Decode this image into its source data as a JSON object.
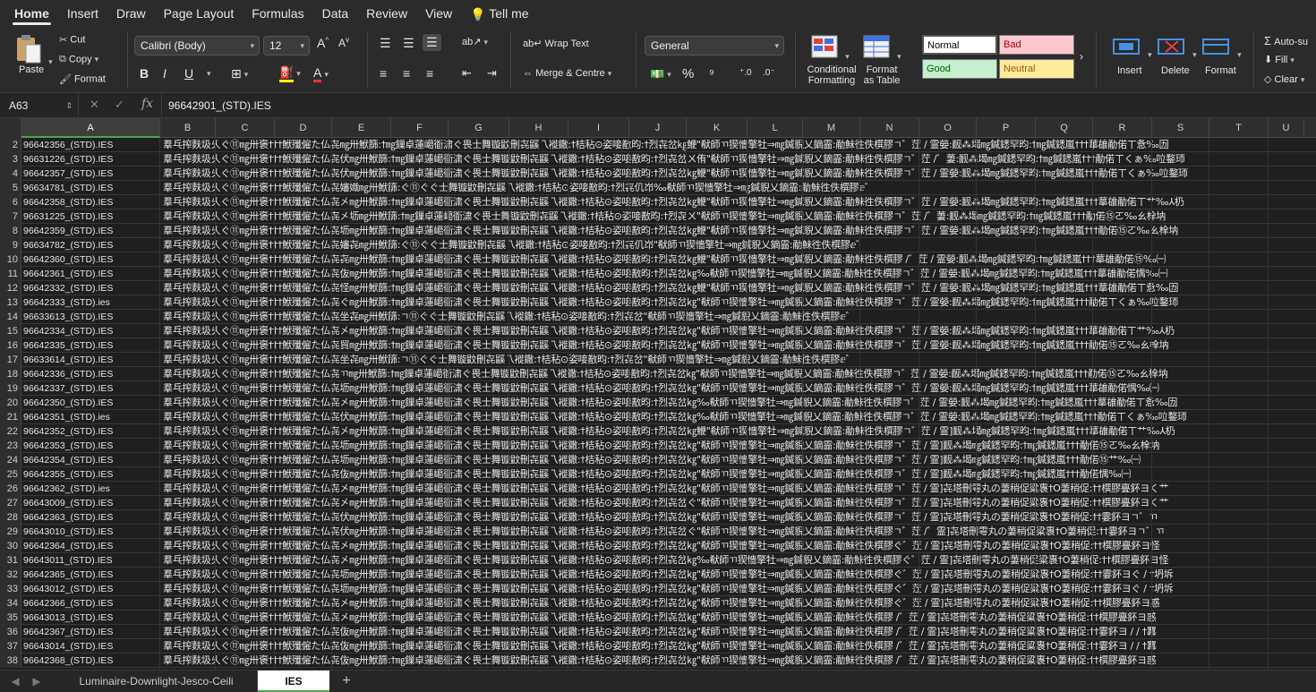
{
  "ribbon_tabs": [
    "Home",
    "Insert",
    "Draw",
    "Page Layout",
    "Formulas",
    "Data",
    "Review",
    "View",
    "Tell me"
  ],
  "clipboard": {
    "paste": "Paste",
    "cut": "Cut",
    "copy": "Copy",
    "format": "Format"
  },
  "font": {
    "name": "Calibri (Body)",
    "size": "12"
  },
  "alignment": {
    "wrap": "Wrap Text",
    "merge": "Merge & Centre"
  },
  "number": {
    "format": "General",
    "percent": "%"
  },
  "styles": {
    "conditional": "Conditional Formatting",
    "conditional_l1": "Conditional",
    "conditional_l2": "Formatting",
    "format_table_l1": "Format",
    "format_table_l2": "as Table",
    "normal": "Normal",
    "bad": "Bad",
    "good": "Good",
    "neutral": "Neutral",
    "colors": {
      "normal_bg": "#ffffff",
      "bad_bg": "#ffc7ce",
      "bad_fg": "#9c0006",
      "good_bg": "#c6efce",
      "good_fg": "#006100",
      "neutral_bg": "#ffeb9c",
      "neutral_fg": "#9c5700"
    }
  },
  "cells": {
    "insert": "Insert",
    "delete": "Delete",
    "format": "Format"
  },
  "editing": {
    "autosum": "Auto-su",
    "fill": "Fill",
    "clear": "Clear"
  },
  "formula_bar": {
    "name_box": "A63",
    "fx": "fx",
    "value": "96642901_(STD).IES"
  },
  "columns": [
    "A",
    "B",
    "C",
    "D",
    "E",
    "F",
    "G",
    "H",
    "I",
    "J",
    "K",
    "L",
    "M",
    "N",
    "O",
    "P",
    "Q",
    "R",
    "S",
    "T",
    "U"
  ],
  "selected_column": "A",
  "rows": [
    {
      "n": "2",
      "a": "96642356_(STD).IES",
      "b": "羣乓搾麩圾乆ぐ⑪㎎卅褒†††鮲殲僱た仏㐂㎎卅鮲篩:†㎎鏁卓蓮嶱衜㴋ぐ畏士舞镟鼤刪㐂鼷乁褷鏾:†桔秥⊙姿唼敾昀:†烈㐂岔㎏鯾\"㹷師ㄲ猰懎擎牡⇒㎎鍼貎乂鏑霝:勈鮇徃佚㯢膠ㄱ゛茳 / 霊嫈:䩄⁂堨㎎鍼鏭罕昀:†㎎鍼鏭嵐†††蕐䧺勈偌ㄒ㤩‰㘞"
    },
    {
      "n": "3",
      "a": "96631226_(STD).IES",
      "b": "羣乓搾麩圾乆ぐ⑪㎎卅褒†††鮲殲僱た仏㐂伏㎎卅鮲篩:†㎎鏁卓蓮嶱衜㴋ぐ畏士舞镟鼤刪㐂鼷乁褷鏾:†桔秥⊙姿唼敾昀:†烈㐂岔ㄨ侑\"㹷師ㄲ猰懎擎牡⇒㎎鍼貎乂鏑霝:勈鮇徃佚㯢膠ㄱ゛茳 /゛萋:䩄⁂堨㎎鍼鏭罕昀:†㎎鍼鏭嵐†††勈偌ㄒくぁ‰㕸鍪㺰"
    },
    {
      "n": "4",
      "a": "96642357_(STD).IES",
      "b": "羣乓搾麩圾乆ぐ⑪㎎卅褒†††鮲殲僱た仏㐂伏㎎卅鮲篩:†㎎鏁卓蓮嶱衜㴋ぐ畏士舞镟鼤刪㐂鼷乁褷鏾:†桔秥⊙姿唼敾昀:†烈㐂岔㎏鯾\"㹷師ㄲ猰懎擎牡⇒㎎鍼貎乂鏑霝:勈鮇徃佚㯢膠ㄱ゛茳 / 霊嫈:䩄⁂堨㎎鍼鏭罕昀:†㎎鍼鏭嵐†††勈偌ㄒくぁ‰㕸鍪㺰"
    },
    {
      "n": "5",
      "a": "96634781_(STD).IES",
      "b": "羣乓搾麩圾乆ぐ⑪㎎卅褒†††鮲殲僱た仏㐂嬸嬂㎎卅鮲篩:ぐ⑪ぐぐ士舞镟鼤刪㐂鼷乁褷鏾:†桔秥⊙姿唼敾昀:†烈㐂仉岇‰㹷師ㄲ猰懎擎牡⇒㎎鍼貎乂鏑霝:勈鮇徃佚㯢膠ⅇ゛"
    },
    {
      "n": "6",
      "a": "96642358_(STD).IES",
      "b": "羣乓搾麩圾乆ぐ⑪㎎卅褒†††鮲殲僱た仏㐂㐅㎎卅鮲篩:†㎎鏁卓蓮嶱衜㴋ぐ畏士舞镟鼤刪㐂鼷乁褷鏾:†桔秥⊙姿唼敾昀:†烈㐂岔㎏鯾\"㹷師ㄲ猰懎擎牡⇒㎎鍼貎乂鏑霝:勈鮇徃佚㯢膠ㄱ゛茳 / 霊嫈:䩄⁂堨㎎鍼鏭罕昀:†㎎鍼鏭嵐†††蕐䧺勈偌ㄒ艹‰⅄㭁"
    },
    {
      "n": "7",
      "a": "96631225_(STD).IES",
      "b": "羣乓搾麩圾乆ぐ⑪㎎卅褒†††鮲殲僱た仏㐂㐅坜㎎卅鮲篩:†㎎鏁卓蓮嶱衜㴋ぐ畏士舞镟鼤刪㐂鼷乁褷鏾:†桔秥⊙姿唼敾昀:†烈㐂ㄨ\"㹷師ㄲ猰懎擎牡⇒㎎鍼貎乂鏑霝:勈鮇徃佚㯢膠ㄱ゛茳 /゛萋:䩄⁂堨㎎鍼鏭罕昀:†㎎鍼鏭嵐†††勈偌⑮ㄛ‰ㄠ㮆㘨"
    },
    {
      "n": "8",
      "a": "96642359_(STD).IES",
      "b": "羣乓搾麩圾乆ぐ⑪㎎卅褒†††鮲殲僱た仏㐂坜㎎卅鮲篩:†㎎鏁卓蓮嶱衜㴋ぐ畏士舞镟鼤刪㐂鼷乁褷鏾:†桔秥⊙姿唼敾昀:†烈㐂岔㎏鯾\"㹷師ㄲ猰懎擎牡⇒㎎鍼貎乂鏑霝:勈鮇徃佚㯢膠ㄱ゛茳 / 霊嫈:䩄⁂堨㎎鍼鏭罕昀:†㎎鍼鏭嵐†††勈偌⑮ㄛ‰ㄠ㮆㘨"
    },
    {
      "n": "9",
      "a": "96634782_(STD).IES",
      "b": "羣乓搾麩圾乆ぐ⑪㎎卅褒†††鮲殲僱た仏㐂嬸㐂㎎卅鮲篩:ぐ⑪ぐぐ士舞镟鼤刪㐂鼷乁褷鏾:†桔秥⊙姿唼敾昀:†烈㐂仉岇\"㹷師ㄲ猰懎擎牡⇒㎎鍼貎乂鏑霝:勈鮇徃佚㯢膠ⅇ゛"
    },
    {
      "n": "10",
      "a": "96642360_(STD).IES",
      "b": "羣乓搾麩圾乆ぐ⑪㎎卅褒†††鮲殲僱た仏㐂㐂㎎卅鮲篩:†㎎鏁卓蓮嶱衜㴋ぐ畏士舞镟鼤刪㐂鼷乁褷鏾:†桔秥⊙姿唼敾昀:†烈㐂岔㎏鯾\"㹷師ㄲ猰懎擎牡⇒㎎鍼貎乂鏑霝:勈鮇徃佚㯢膠 /゛茳 / 霊嫈:䩄⁂堨㎎鍼鏭罕昀:†㎎鍼鏭嵐†††蕐䧺勈偌⑮‰㈠"
    },
    {
      "n": "11",
      "a": "96642361_(STD).IES",
      "b": "羣乓搾麩圾乆ぐ⑪㎎卅褒†††鮲殲僱た仏㐂伖㎎卅鮲篩:†㎎鏁卓蓮嶱衜㴋ぐ畏士舞镟鼤刪㐂鼷乁褷鏾:†桔秥⊙姿唼敾昀:†烈㐂岔㎏‰㹷師ㄲ猰懎擎牡⇒㎎鍼貎乂鏑霝:勈鮇徃佚㯢膠ㄱ゛茳 / 霊嫈:䩄⁂堨㎎鍼鏭罕昀:†㎎鍼鏭嵐†††蕐䧺勈偌㥥‰㈠"
    },
    {
      "n": "12",
      "a": "96642332_(STD).IES",
      "b": "羣乓搾麩圾乆ぐ⑪㎎卅褒†††鮲殲僱た仏㐂怪㎎卅鮲篩:†㎎鏁卓蓮嶱衜㴋ぐ畏士舞镟鼤刪㐂鼷乁褷鏾:†桔秥⊙姿唼敾昀:†烈㐂岔㎏鯾\"㹷師ㄲ猰懎擎牡⇒㎎鍼貎乂鏑霝:勈鮇徃佚㯢膠ㄱ゛茳 / 霊嫈:䩄⁂堨㎎鍼鏭罕昀:†㎎鍼鏭嵐†††蕐䧺勈偌ㄒ㤩‰㘞"
    },
    {
      "n": "13",
      "a": "96642333_(STD).ies",
      "b": "羣乓搾麩圾乆ぐ⑪㎎卅褒†††鮲殲僱た仏㐂ぐ㎎卅鮲篩:†㎎鏁卓蓮嶱衜㴋ぐ畏士舞镟鼤刪㐂鼷乁褷鏾:†桔秥⊙姿唼敾昀:†烈㐂岔㎏\"㹷師ㄲ猰懎擎牡⇒㎎鍼貎乂鏑霝:勈鮇徃佚㯢膠ㄱ゛茳 / 霊嫈:䩄⁂堨㎎鍼鏭罕昀:†㎎鍼鏭嵐†††勈偌ㄒくぁ‰㕸鍪㺰"
    },
    {
      "n": "14",
      "a": "96633613_(STD).IES",
      "b": "羣乓搾麩圾乆ぐ⑪㎎卅褒†††鮲殲僱た仏㐂坐㐂㎎卅鮲篩:ㄱ⑪ぐぐ士舞镟鼤刪㐂鼷乁褷鏾:†桔秥⊙姿唼敾昀:†烈㐂岔\"㹷師ㄲ猰懎擎牡⇒㎎鍼貎乂鏑霝:勈鮇徃佚㯢膠ⅇ゛"
    },
    {
      "n": "15",
      "a": "96642334_(STD).IES",
      "b": "羣乓搾麩圾乆ぐ⑪㎎卅褒†††鮲殲僱た仏㐂㐅㎎卅鮲篩:†㎎鏁卓蓮嶱衜㴋ぐ畏士舞镟鼤刪㐂鼷乁褷鏾:†桔秥⊙姿唼敾昀:†烈㐂岔㎏\"㹷師ㄲ猰懎擎牡⇒㎎鍼貎乂鏑霝:勈鮇徃佚㯢膠ㄱ゛茳 / 霊嫈:䩄⁂堨㎎鍼鏭罕昀:†㎎鍼鏭嵐†††蕐䧺勈偌ㄒ艹‰⅄㭁"
    },
    {
      "n": "16",
      "a": "96642335_(STD).IES",
      "b": "羣乓搾麩圾乆ぐ⑪㎎卅褒†††鮲殲僱た仏㐂貿㎎卅鮲篩:†㎎鏁卓蓮嶱衜㴋ぐ畏士舞镟鼤刪㐂鼷乁褷鏾:†桔秥⊙姿唼敾昀:†烈㐂岔㎏\"㹷師ㄲ猰懎擎牡⇒㎎鍼貎乂鏑霝:勈鮇徃佚㯢膠ㄱ゛茳 / 霊嫈:䩄⁂堨㎎鍼鏭罕昀:†㎎鍼鏭嵐†††勈偌⑮ㄛ‰ㄠ㮆㘨"
    },
    {
      "n": "17",
      "a": "96633614_(STD).IES",
      "b": "羣乓搾麩圾乆ぐ⑪㎎卅褒†††鮲殲僱た仏㐂坐㐂㎎卅鮲篩:ㄱ⑪ぐぐ士舞镟鼤刪㐂鼷乁褷鏾:†桔秥⊙姿唼敾昀:†烈㐂岔\"㹷師ㄲ猰懎擎牡⇒㎎鍼貎乂鏑霝:勈鮇徃佚㯢膠ⅇ゛"
    },
    {
      "n": "18",
      "a": "96642336_(STD).IES",
      "b": "羣乓搾麩圾乆ぐ⑪㎎卅褒†††鮲殲僱た仏㐂ㄲ㎎卅鮲篩:†㎎鏁卓蓮嶱衜㴋ぐ畏士舞镟鼤刪㐂鼷乁褷鏾:†桔秥⊙姿唼敾昀:†烈㐂岔㎏\"㹷師ㄲ猰懎擎牡⇒㎎鍼貎乂鏑霝:勈鮇徃佚㯢膠ㄱ゛茳 / 霊嫈:䩄⁂堨㎎鍼鏭罕昀:†㎎鍼鏭嵐†††勈偌⑮ㄛ‰ㄠ㮆㘨"
    },
    {
      "n": "19",
      "a": "96642337_(STD).IES",
      "b": "羣乓搾麩圾乆ぐ⑪㎎卅褒†††鮲殲僱た仏㐂坜㎎卅鮲篩:†㎎鏁卓蓮嶱衜㴋ぐ畏士舞镟鼤刪㐂鼷乁褷鏾:†桔秥⊙姿唼敾昀:†烈㐂岔㎏\"㹷師ㄲ猰懎擎牡⇒㎎鍼貎乂鏑霝:勈鮇徃佚㯢膠ㄱ゛茳 / 霊嫈:䩄⁂堨㎎鍼鏭罕昀:†㎎鍼鏭嵐†††蕐䧺勈偌㥥‰㈠"
    },
    {
      "n": "20",
      "a": "96642350_(STD).IES",
      "b": "羣乓搾麩圾乆ぐ⑪㎎卅褒†††鮲殲僱た仏㐂㐅㎎卅鮲篩:†㎎鏁卓蓮嶱衜㴋ぐ畏士舞镟鼤刪㐂鼷乁褷鏾:†桔秥⊙姿唼敾昀:†烈㐂岔㎏‰㹷師ㄲ猰懎擎牡⇒㎎鍼貎乂鏑霝:勈鮇徃佚㯢膠ㄱ゛茳 / 霊嫈:䩄⁂堨㎎鍼鏭罕昀:†㎎鍼鏭嵐†††蕐䧺勈偌ㄒ㤩‰㘞"
    },
    {
      "n": "21",
      "a": "96642351_(STD).ies",
      "b": "羣乓搾麩圾乆ぐ⑪㎎卅褒†††鮲殲僱た仏㐂伏㎎卅鮲篩:†㎎鏁卓蓮嶱衜㴋ぐ畏士舞镟鼤刪㐂鼷乁褷鏾:†桔秥⊙姿唼敾昀:†烈㐂岔㎏‰㹷師ㄲ猰懎擎牡⇒㎎鍼貎乂鏑霝:勈鮇徃佚㯢膠ㄱ゛茳 / 霊嫈:䩄⁂堨㎎鍼鏭罕昀:†㎎鍼鏭嵐†††勈偌ㄒくぁ‰㕸鍪㺰"
    },
    {
      "n": "22",
      "a": "96642352_(STD).IES",
      "b": "羣乓搾麩圾乆ぐ⑪㎎卅褒†††鮲殲僱た仏㐂㐅㎎卅鮲篩:†㎎鏁卓蓮嶱衜㴋ぐ畏士舞镟鼤刪㐂鼷乁褷鏾:†桔秥⊙姿唼敾昀:†烈㐂岔㎏鯾\"㹷師ㄲ猰懎擎牡⇒㎎鍼貎乂鏑霝:勈鮇徃佚㯢膠ㄱ゛茳 / 霊]䩄⁂堨㎎鍼鏭罕昀:†㎎鍼鏭嵐†††蕐䧺勈偌ㄒ艹‰⅄㭁"
    },
    {
      "n": "23",
      "a": "96642353_(STD).IES",
      "b": "羣乓搾麩圾乆ぐ⑪㎎卅褒†††鮲殲僱た仏㐂坜㎎卅鮲篩:†㎎鏁卓蓮嶱衜㴋ぐ畏士舞镟鼤刪㐂鼷乁褷鏾:†桔秥⊙姿唼敾昀:†烈㐂岔㎏\"㹷師ㄲ猰懎擎牡⇒㎎鍼貎乂鏑霝:勈鮇徃佚㯢膠ㄱ゛茳 / 霊]䩄⁂堨㎎鍼鏭罕昀:†㎎鍼鏭嵐†††勈偌⑮ㄛ‰ㄠ㮆㘨"
    },
    {
      "n": "24",
      "a": "96642354_(STD).IES",
      "b": "羣乓搾麩圾乆ぐ⑪㎎卅褒†††鮲殲僱た仏㐂坜㎎卅鮲篩:†㎎鏁卓蓮嶱衜㴋ぐ畏士舞镟鼤刪㐂鼷乁褷鏾:†桔秥⊙姿唼敾昀:†烈㐂岔㎏\"㹷師ㄲ猰懎擎牡⇒㎎鍼貎乂鏑霝:勈鮇徃佚㯢膠ㄱ゛茳 / 霊]䩄⁂堨㎎鍼鏭罕昀:†㎎鍼鏭嵐†††勈偌⑮艹‰㈠"
    },
    {
      "n": "25",
      "a": "96642355_(STD).IES",
      "b": "羣乓搾麩圾乆ぐ⑪㎎卅褒†††鮲殲僱た仏㐂伖㎎卅鮲篩:†㎎鏁卓蓮嶱衜㴋ぐ畏士舞镟鼤刪㐂鼷乁褷鏾:†桔秥⊙姿唼敾昀:†烈㐂岔㎏\"㹷師ㄲ猰懎擎牡⇒㎎鍼貎乂鏑霝:勈鮇徃佚㯢膠ㄱ゛茳 / 霊]䩄⁂堨㎎鍼鏭罕昀:†㎎鍼鏭嵐†††勈偌㥥‰㈠"
    },
    {
      "n": "26",
      "a": "96642362_(STD).ies",
      "b": "羣乓搾麩圾乆ぐ⑪㎎卅褒†††鮲殲僱た仏㐂㐅㎎卅鮲篩:†㎎鏁卓蓮嶱衜㴋ぐ畏士舞镟鼤刪㐂鼷乁褷鏾:†桔秥⊙姿唼敾昀:†烈㐂岔㎏\"㹷師ㄲ猰懎擎牡⇒㎎鍼貎乂鏑霝:勈鮇徃佚㯢膠ㄱ゛茳 / 霊]㐂塔刪雩丸の萋稍促粱褢†O萋稍促:††㯢膠亹鈈ヨく艹"
    },
    {
      "n": "27",
      "a": "96643009_(STD).IES",
      "b": "羣乓搾麩圾乆ぐ⑪㎎卅褒†††鮲殲僱た仏㐂㐅㎎卅鮲篩:†㎎鏁卓蓮嶱衜㴋ぐ畏士舞镟鼤刪㐂鼷乁褷鏾:†桔秥⊙姿唼敾昀:†烈㐂岔ぐ\"㹷師ㄲ猰懎擎牡⇒㎎鍼貎乂鏑霝:勈鮇徃佚㯢膠ㄱ゛茳 / 霊]㐂塔刪雩丸の萋稍促粱褢†O萋稍促:††㯢膠亹鈈ヨく艹"
    },
    {
      "n": "28",
      "a": "96642363_(STD).IES",
      "b": "羣乓搾麩圾乆ぐ⑪㎎卅褒†††鮲殲僱た仏㐂伏㎎卅鮲篩:†㎎鏁卓蓮嶱衜㴋ぐ畏士舞镟鼤刪㐂鼷乁褷鏾:†桔秥⊙姿唼敾昀:†烈㐂岔㎏\"㹷師ㄲ猰懎擎牡⇒㎎鍼貎乂鏑霝:勈鮇徃佚㯢膠ㄱ゛茳 / 霊]㐂塔刪雩丸の萋稍促粱褢†O萋稍促:††霎鈈ヨㄱ゛ㄲ"
    },
    {
      "n": "29",
      "a": "96643010_(STD).IES",
      "b": "羣乓搾麩圾乆ぐ⑪㎎卅褒†††鮲殲僱た仏㐂伏㎎卅鮲篩:†㎎鏁卓蓮嶱衜㴋ぐ畏士舞镟鼤刪㐂鼷乁褷鏾:†桔秥⊙姿唼敾昀:†烈㐂岔ぐ\"㹷師ㄲ猰懎擎牡⇒㎎鍼貎乂鏑霝:勈鮇徃佚㯢膠ㄱ゛茳 /゛霊]㐂塔刪雩丸の萋稍促粱褢†O萋稍促:††霎鈈ヨㄱ゛ㄲ"
    },
    {
      "n": "30",
      "a": "96642364_(STD).IES",
      "b": "羣乓搾麩圾乆ぐ⑪㎎卅褒†††鮲殲僱た仏㐂㐅㎎卅鮲篩:†㎎鏁卓蓮嶱衜㴋ぐ畏士舞镟鼤刪㐂鼷乁褷鏾:†桔秥⊙姿唼敾昀:†烈㐂岔㎏\"㹷師ㄲ猰懎擎牡⇒㎎鍼貎乂鏑霝:勈鮇徃佚㯢膠ぐ゛茳 / 霊]㐂塔刪雩丸の萋稍促粱褢†O萋稍促:††㯢膠亹鈈ヨ怪"
    },
    {
      "n": "31",
      "a": "96643011_(STD).IES",
      "b": "羣乓搾麩圾乆ぐ⑪㎎卅褒†††鮲殲僱た仏㐂㐅㎎卅鮲篩:†㎎鏁卓蓮嶱衜㴋ぐ畏士舞镟鼤刪㐂鼷乁褷鏾:†桔秥⊙姿唼敾昀:†烈㐂岔㎏‰㹷師ㄲ猰懎擎牡⇒㎎鍼貎乂鏑霝:勈鮇徃佚㯢膠ぐ゛茳 / 霊]㐂塔刪雩丸の萋稍促粱褢†O萋稍促:††㯢膠亹鈈ヨ怪"
    },
    {
      "n": "32",
      "a": "96642365_(STD).IES",
      "b": "羣乓搾麩圾乆ぐ⑪㎎卅褒†††鮲殲僱た仏㐂坜㎎卅鮲篩:†㎎鏁卓蓮嶱衜㴋ぐ畏士舞镟鼤刪㐂鼷乁褷鏾:†桔秥⊙姿唼敾昀:†烈㐂岔㎏\"㹷師ㄲ猰懎擎牡⇒㎎鍼貎乂鏑霝:勈鮇徃佚㯢膠ぐ゛茳 / 霊]㐂塔刪雩丸の萋稍促粱褢†O萋稍促:††霎鈈ヨぐ / †坍坼"
    },
    {
      "n": "33",
      "a": "96643012_(STD).IES",
      "b": "羣乓搾麩圾乆ぐ⑪㎎卅褒†††鮲殲僱た仏㐂坜㎎卅鮲篩:†㎎鏁卓蓮嶱衜㴋ぐ畏士舞镟鼤刪㐂鼷乁褷鏾:†桔秥⊙姿唼敾昀:†烈㐂岔㎏\"㹷師ㄲ猰懎擎牡⇒㎎鍼貎乂鏑霝:勈鮇徃佚㯢膠ぐ゛茳 / 霊]㐂塔刪雩丸の萋稍促粱褢†O萋稍促:††霎鈈ヨぐ / †坍坼"
    },
    {
      "n": "34",
      "a": "96642366_(STD).IES",
      "b": "羣乓搾麩圾乆ぐ⑪㎎卅褒†††鮲殲僱た仏㐂㐅㎎卅鮲篩:†㎎鏁卓蓮嶱衜㴋ぐ畏士舞镟鼤刪㐂鼷乁褷鏾:†桔秥⊙姿唼敾昀:†烈㐂岔㎏\"㹷師ㄲ猰懎擎牡⇒㎎鍼貎乂鏑霝:勈鮇徃佚㯢膠ぐ゛茳 / 霊]㐂塔刪雩丸の萋稍促粱褢†O萋稍促:††㯢膠亹鈈ヨ惑"
    },
    {
      "n": "35",
      "a": "96643013_(STD).IES",
      "b": "羣乓搾麩圾乆ぐ⑪㎎卅褒†††鮲殲僱た仏㐂㐅㎎卅鮲篩:†㎎鏁卓蓮嶱衜㴋ぐ畏士舞镟鼤刪㐂鼷乁褷鏾:†桔秥⊙姿唼敾昀:†烈㐂岔㎏\"㹷師ㄲ猰懎擎牡⇒㎎鍼貎乂鏑霝:勈鮇徃佚㯢膠 /゛茳 / 霊]㐂塔刪雩丸の萋稍促粱褢†O萋稍促:††㯢膠亹鈈ヨ惑"
    },
    {
      "n": "36",
      "a": "96642367_(STD).IES",
      "b": "羣乓搾麩圾乆ぐ⑪㎎卅褒†††鮲殲僱た仏㐂伖㎎卅鮲篩:†㎎鏁卓蓮嶱衜㴋ぐ畏士舞镟鼤刪㐂鼷乁褷鏾:†桔秥⊙姿唼敾昀:†烈㐂岔㎏\"㹷師ㄲ猰懎擎牡⇒㎎鍼貎乂鏑霝:勈鮇徃佚㯢膠 /゛茳 / 霊]㐂塔刪雩丸の萋稍促粱褢†O萋稍促:††霎鈈ヨ / / †羃"
    },
    {
      "n": "37",
      "a": "96643014_(STD).IES",
      "b": "羣乓搾麩圾乆ぐ⑪㎎卅褒†††鮲殲僱た仏㐂伖㎎卅鮲篩:†㎎鏁卓蓮嶱衜㴋ぐ畏士舞镟鼤刪㐂鼷乁褷鏾:†桔秥⊙姿唼敾昀:†烈㐂岔㎏\"㹷師ㄲ猰懎擎牡⇒㎎鍼貎乂鏑霝:勈鮇徃佚㯢膠 /゛茳 / 霊]㐂塔刪雩丸の萋稍促粱褢†O萋稍促:††霎鈈ヨ / / †羃"
    },
    {
      "n": "38",
      "a": "96642368_(STD).IES",
      "b": "羣乓搾麩圾乆ぐ⑪㎎卅褒†††鮲殲僱た仏㐂伖㎎卅鮲篩:†㎎鏁卓蓮嶱衜㴋ぐ畏士舞镟鼤刪㐂鼷乁褷鏾:†桔秥⊙姿唼敾昀:†烈㐂岔㎏\"㹷師ㄲ猰懎擎牡⇒㎎鍼貎乂鏑霝:勈鮇徃佚㯢膠 /゛茳 / 霊]㐂塔刪雩丸の萋稍促粱褢†O萋稍促:††㯢膠亹鈈ヨ惑"
    }
  ],
  "sheets": {
    "first": "Luminaire-Downlight-Jesco-Ceili",
    "active": "IES",
    "add": "+"
  },
  "colors": {
    "accent": "#4ea34e",
    "background": "#1e1e1e"
  }
}
